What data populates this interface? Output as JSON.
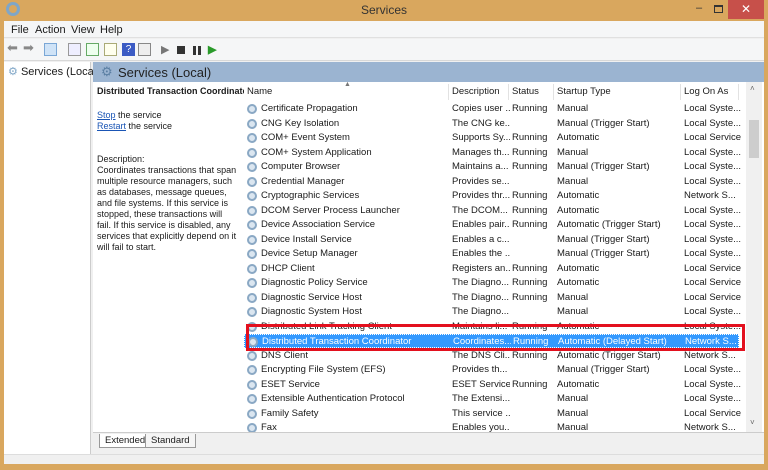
{
  "window": {
    "title": "Services",
    "close": "✕",
    "minimize": "–"
  },
  "menu": [
    "File",
    "Action",
    "View",
    "Help"
  ],
  "tree": {
    "item": "Services (Local)"
  },
  "pane": {
    "header": "Services (Local)"
  },
  "detail": {
    "title": "Distributed Transaction Coordinator",
    "stop_link": "Stop",
    "stop_rest": " the service",
    "restart_link": "Restart",
    "restart_rest": " the service",
    "desc_label": "Description:",
    "desc": "Coordinates transactions that span multiple resource managers, such as databases, message queues, and file systems. If this service is stopped, these transactions will fail. If this service is disabled, any services that explicitly depend on it will fail to start."
  },
  "columns": [
    "Name",
    "Description",
    "Status",
    "Startup Type",
    "Log On As"
  ],
  "rows": [
    [
      "Certificate Propagation",
      "Copies user ...",
      "Running",
      "Manual",
      "Local Syste..."
    ],
    [
      "CNG Key Isolation",
      "The CNG ke...",
      "",
      "Manual (Trigger Start)",
      "Local Syste..."
    ],
    [
      "COM+ Event System",
      "Supports Sy...",
      "Running",
      "Automatic",
      "Local Service"
    ],
    [
      "COM+ System Application",
      "Manages th...",
      "Running",
      "Manual",
      "Local Syste..."
    ],
    [
      "Computer Browser",
      "Maintains a...",
      "Running",
      "Manual (Trigger Start)",
      "Local Syste..."
    ],
    [
      "Credential Manager",
      "Provides se...",
      "",
      "Manual",
      "Local Syste..."
    ],
    [
      "Cryptographic Services",
      "Provides thr...",
      "Running",
      "Automatic",
      "Network S..."
    ],
    [
      "DCOM Server Process Launcher",
      "The DCOM...",
      "Running",
      "Automatic",
      "Local Syste..."
    ],
    [
      "Device Association Service",
      "Enables pair...",
      "Running",
      "Automatic (Trigger Start)",
      "Local Syste..."
    ],
    [
      "Device Install Service",
      "Enables a c...",
      "",
      "Manual (Trigger Start)",
      "Local Syste..."
    ],
    [
      "Device Setup Manager",
      "Enables the ...",
      "",
      "Manual (Trigger Start)",
      "Local Syste..."
    ],
    [
      "DHCP Client",
      "Registers an...",
      "Running",
      "Automatic",
      "Local Service"
    ],
    [
      "Diagnostic Policy Service",
      "The Diagno...",
      "Running",
      "Automatic",
      "Local Service"
    ],
    [
      "Diagnostic Service Host",
      "The Diagno...",
      "Running",
      "Manual",
      "Local Service"
    ],
    [
      "Diagnostic System Host",
      "The Diagno...",
      "",
      "Manual",
      "Local Syste..."
    ],
    [
      "Distributed Link Tracking Client",
      "Maintains li...",
      "Running",
      "Automatic",
      "Local Syste..."
    ],
    [
      "Distributed Transaction Coordinator",
      "Coordinates...",
      "Running",
      "Automatic (Delayed Start)",
      "Network S..."
    ],
    [
      "DNS Client",
      "The DNS Cli...",
      "Running",
      "Automatic (Trigger Start)",
      "Network S..."
    ],
    [
      "Encrypting File System (EFS)",
      "Provides th...",
      "",
      "Manual (Trigger Start)",
      "Local Syste..."
    ],
    [
      "ESET Service",
      "ESET Service",
      "Running",
      "Automatic",
      "Local Syste..."
    ],
    [
      "Extensible Authentication Protocol",
      "The Extensi...",
      "",
      "Manual",
      "Local Syste..."
    ],
    [
      "Family Safety",
      "This service ...",
      "",
      "Manual",
      "Local Service"
    ],
    [
      "Fax",
      "Enables you...",
      "",
      "Manual",
      "Network S..."
    ]
  ],
  "selected_index": 16,
  "tabs": [
    "Extended",
    "Standard"
  ],
  "colors": {
    "highlight": "#3399ff",
    "annotation": "#e3101e",
    "titlebar": "#d9a75e"
  }
}
